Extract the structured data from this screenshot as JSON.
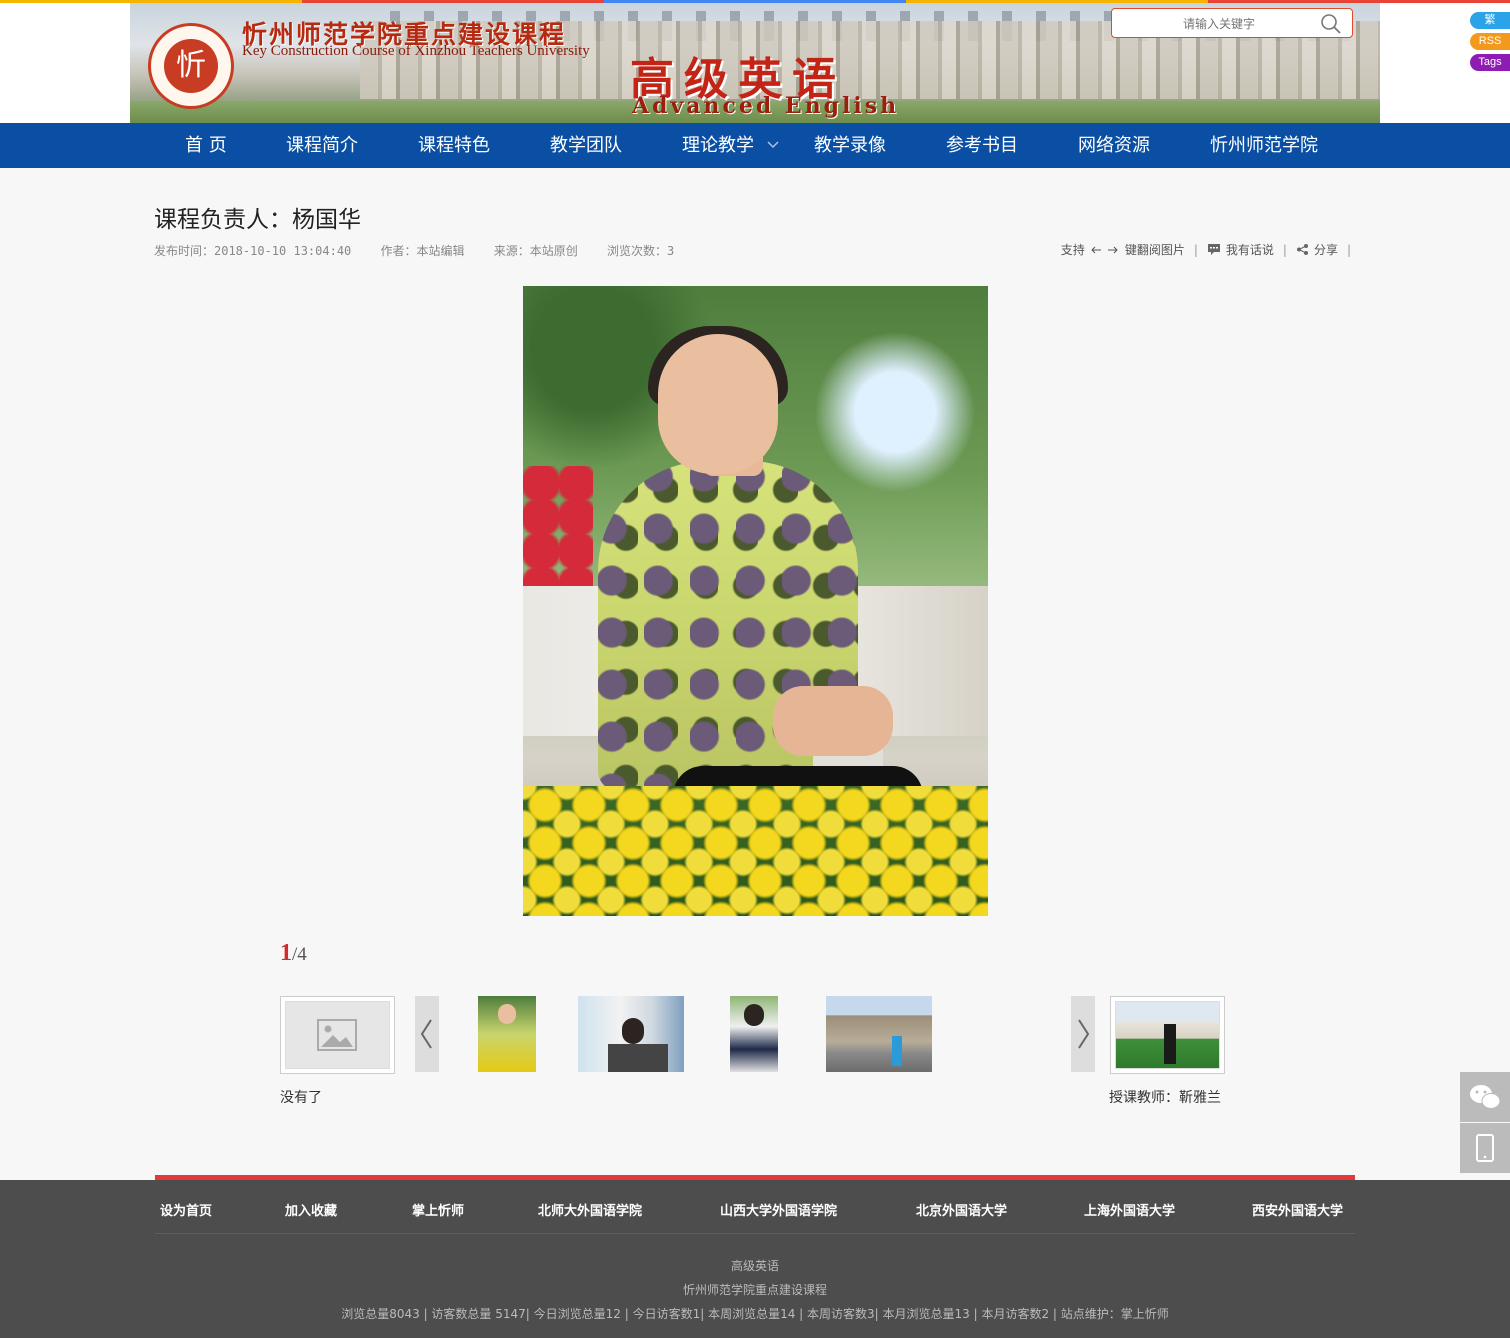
{
  "colors": {
    "stripe": [
      "#f4b400",
      "#e94335",
      "#4285f4",
      "#f4b400",
      "#e94335"
    ],
    "nav_bg": "#0a4fa3",
    "accent_red": "#e03a3a",
    "footer_bg": "#4d4d4d",
    "tag_fan": "#2aa3e8",
    "tag_rss": "#f39a1e",
    "tag_tags": "#8e1cb3"
  },
  "banner": {
    "logo_char": "忻",
    "title_cn": "忻州师范学院重点建设课程",
    "title_en": "Key Construction Course of Xinzhou Teachers University",
    "course_cn": "高级英语",
    "course_en": "Advanced English"
  },
  "search": {
    "placeholder": "请输入关键字",
    "icon": "search-icon"
  },
  "side_tags": [
    "繁",
    "RSS",
    "Tags"
  ],
  "nav": {
    "items": [
      {
        "label": "首 页"
      },
      {
        "label": "课程简介"
      },
      {
        "label": "课程特色"
      },
      {
        "label": "教学团队"
      },
      {
        "label": "理论教学",
        "has_dropdown": true
      },
      {
        "label": "教学录像"
      },
      {
        "label": "参考书目"
      },
      {
        "label": "网络资源"
      },
      {
        "label": "忻州师范学院"
      }
    ]
  },
  "article": {
    "title": "课程负责人：杨国华",
    "meta": {
      "publish": "发布时间：2018-10-10 13:04:40",
      "author": "作者：本站编辑",
      "source": "来源：本站原创",
      "views": "浏览次数：3"
    },
    "tools": {
      "keyboard_hint_prefix": "支持",
      "keyboard_hint_suffix": "键翻阅图片",
      "comment": "我有话说",
      "share": "分享"
    }
  },
  "gallery": {
    "current": "1",
    "total": "/4",
    "prev_label": "没有了",
    "next_label": "授课教师：靳雅兰",
    "thumbnails": [
      "portrait-flowers",
      "desk-office",
      "portrait-dress",
      "palace-tourist"
    ]
  },
  "footer": {
    "links": [
      "设为首页",
      "加入收藏",
      "掌上忻师",
      "北师大外国语学院",
      "山西大学外国语学院",
      "北京外国语大学",
      "上海外国语大学",
      "西安外国语大学"
    ],
    "line1": "高级英语",
    "line2": "忻州师范学院重点建设课程",
    "stats": "浏览总量8043 | 访客数总量 5147| 今日浏览总量12 | 今日访客数1| 本周浏览总量14 | 本周访客数3| 本月浏览总量13 | 本月访客数2 | 站点维护：掌上忻师"
  }
}
